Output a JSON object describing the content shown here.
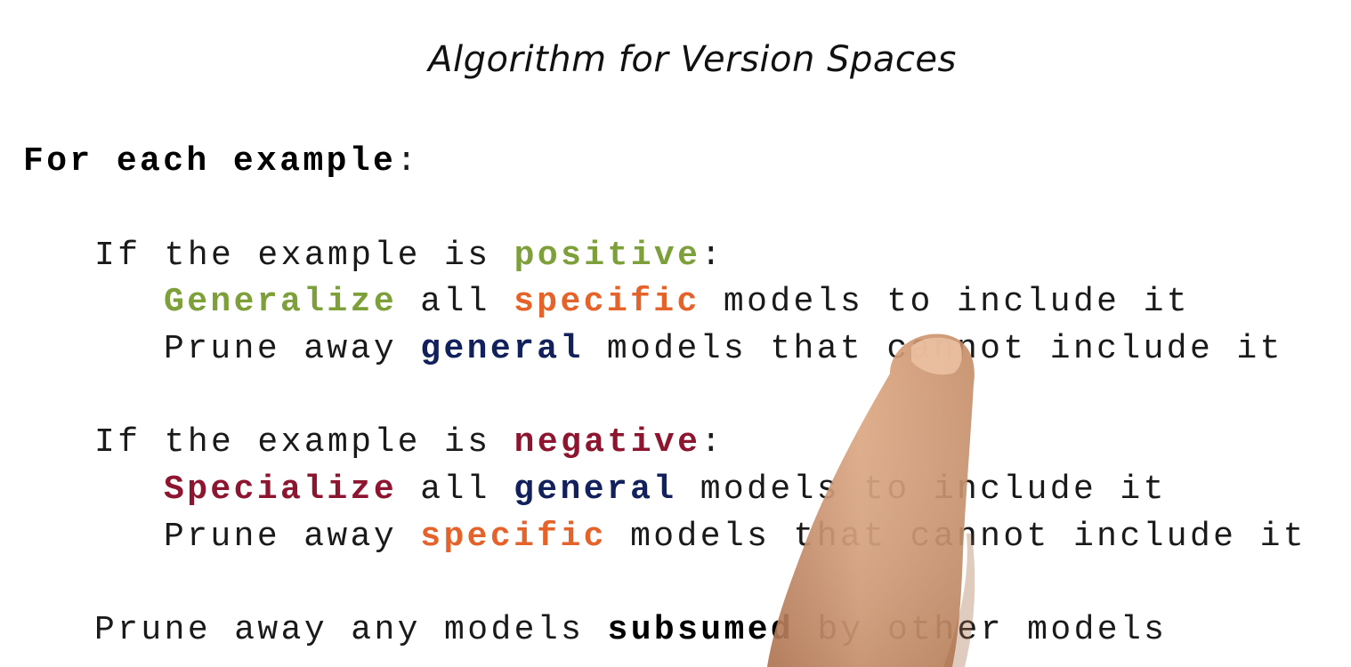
{
  "title": "Algorithm for Version Spaces",
  "lines": [
    {
      "bold_text": "For each example",
      "rest": ":"
    },
    {
      "pre": "If the example is ",
      "kw": "positive",
      "post": ":"
    },
    {
      "kw": "Generalize",
      "mid": " all ",
      "kw2": "specific",
      "post": " models to include it"
    },
    {
      "pre": "Prune away ",
      "kw": "general",
      "post": " models that cannot include it"
    },
    {
      "pre": "If the example is ",
      "kw": "negative",
      "post": ":"
    },
    {
      "kw": "Specialize",
      "mid": " all ",
      "kw2": "general",
      "post": " models to include it"
    },
    {
      "pre": "Prune away ",
      "kw": "specific",
      "post": " models that cannot include it"
    },
    {
      "pre": "Prune away any models ",
      "kw": "subsumed",
      "post": " by other models"
    }
  ],
  "colors": {
    "positive": "#7ea03a",
    "specific": "#e5632a",
    "general": "#12215c",
    "negative": "#8e1530"
  }
}
